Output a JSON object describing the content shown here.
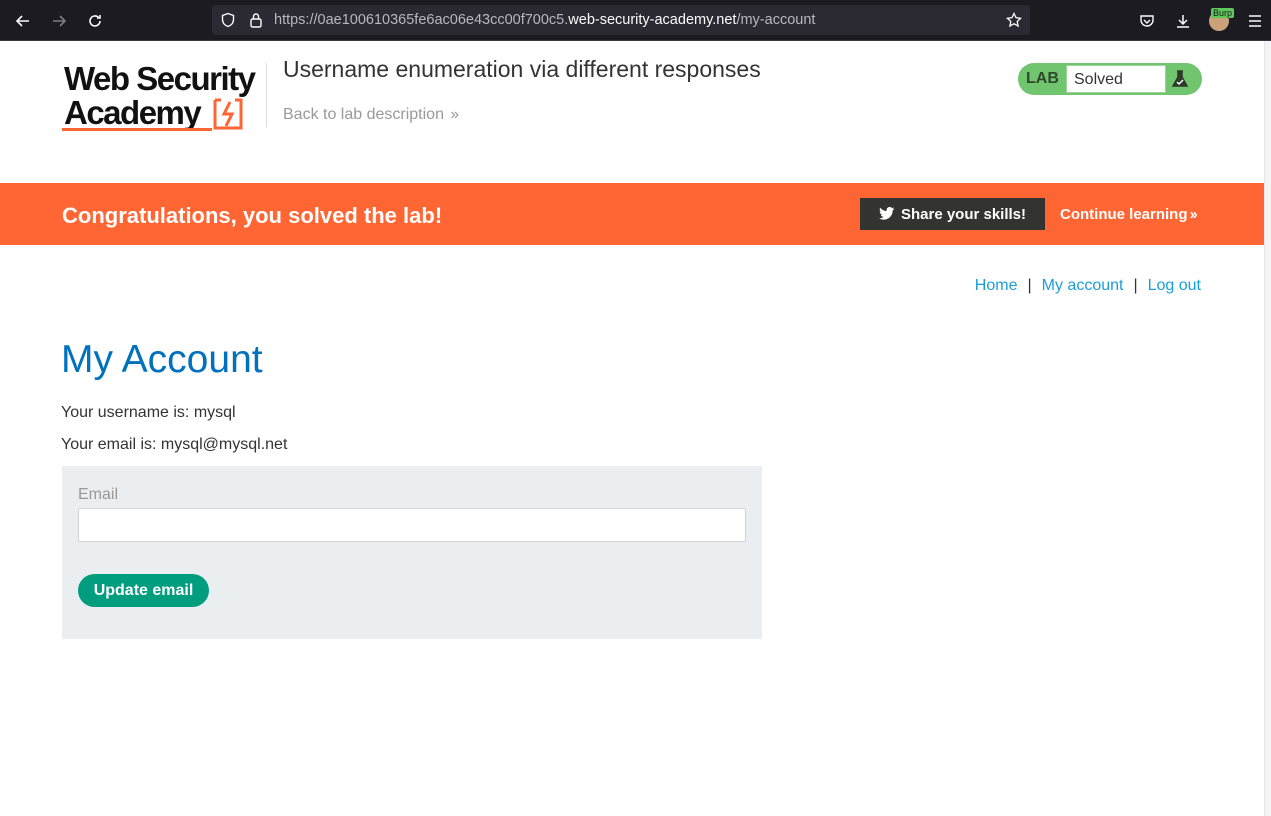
{
  "browser": {
    "url_prefix": "https://0ae100610365fe6ac06e43cc00f700c5.",
    "url_host": "web-security-academy.net",
    "url_path": "/my-account",
    "avatar_badge": "Burp"
  },
  "header": {
    "logo_line1": "Web Security",
    "logo_line2": "Academy",
    "lab_title": "Username enumeration via different responses",
    "back_link": "Back to lab description",
    "lab_badge": "LAB",
    "lab_status": "Solved"
  },
  "banner": {
    "message": "Congratulations, you solved the lab!",
    "share_label": "Share your skills!",
    "continue_label": "Continue learning"
  },
  "nav": {
    "home": "Home",
    "my_account": "My account",
    "log_out": "Log out",
    "separator": "|"
  },
  "main": {
    "heading": "My Account",
    "username_line": "Your username is: mysql",
    "email_line": "Your email is: mysql@mysql.net",
    "email_label": "Email",
    "email_value": "",
    "update_button": "Update email"
  },
  "colors": {
    "banner": "#ff6633",
    "heading": "#0071bc",
    "link": "#1a9ed8",
    "button": "#009d7e",
    "lab_badge": "#70c56e"
  }
}
